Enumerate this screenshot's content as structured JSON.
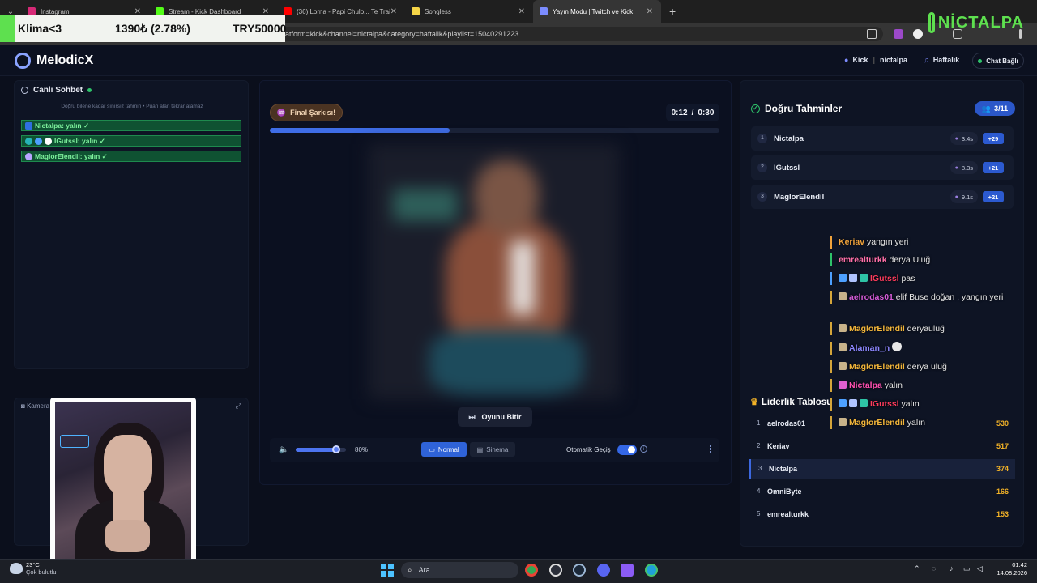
{
  "browser": {
    "tabs": [
      {
        "title": "Instagram",
        "color": "#d62976"
      },
      {
        "title": "Stream - Kick Dashboard",
        "color": "#53fc18"
      },
      {
        "title": "(36) Lorna - Papi Chulo... Te Trai",
        "color": "#ff0000"
      },
      {
        "title": "Songless",
        "color": "#f5d547"
      },
      {
        "title": "Yayın Modu | Twitch ve Kick",
        "color": "#7b8cff"
      }
    ],
    "url": "atform=kick&channel=nictalpa&category=haftalik&playlist=15040291223"
  },
  "ticker": {
    "left": "Klima<3",
    "middle": "1390₺ (2.78%)",
    "right": "TRY50000"
  },
  "brand_overlay": "NİCTALPA",
  "app": {
    "name": "MelodicX",
    "platform": "Kick",
    "channel": "nictalpa",
    "category": "Haftalık",
    "connection": "Chat Bağlı"
  },
  "chat": {
    "title": "Canlı Sohbet",
    "note": "Doğru bilene kadar sınırsız tahmin • Puan alan tekrar alamaz",
    "messages": [
      {
        "text": "Nictalpa: yalın ✓"
      },
      {
        "text": "IGutssl: yalın ✓"
      },
      {
        "text": "MaglorElendil: yalın ✓"
      }
    ]
  },
  "camera": {
    "label": "Kamera Alanı"
  },
  "player": {
    "badge": "Final Şarkısı!",
    "current_time": "0:12",
    "total_time": "0:30",
    "progress": 0.4,
    "end_button": "Oyunu Bitir",
    "volume_pct": 80,
    "volume_label": "80%",
    "mode_normal": "Normal",
    "mode_cinema": "Sinema",
    "auto_label": "Otomatik Geçiş"
  },
  "correct": {
    "title": "Doğru Tahminler",
    "count": "3/11",
    "rows": [
      {
        "rank": "1",
        "name": "Nictalpa",
        "time": "3.4s",
        "points": "+29"
      },
      {
        "rank": "2",
        "name": "IGutssl",
        "time": "8.3s",
        "points": "+21"
      },
      {
        "rank": "3",
        "name": "MaglorElendil",
        "time": "9.1s",
        "points": "+21"
      }
    ]
  },
  "leaderboard": {
    "title": "Liderlik Tablosu",
    "rows": [
      {
        "rank": "1",
        "name": "aelrodas01",
        "score": "530"
      },
      {
        "rank": "2",
        "name": "Keriav",
        "score": "517"
      },
      {
        "rank": "3",
        "name": "Nictalpa",
        "score": "374"
      },
      {
        "rank": "4",
        "name": "OmniByte",
        "score": "166"
      },
      {
        "rank": "5",
        "name": "emrealturkk",
        "score": "153"
      }
    ]
  },
  "overlay_chat": [
    {
      "user": "Keriav",
      "text": "yangın yeri",
      "color": "#f0a33c"
    },
    {
      "user": "emrealturkk",
      "text": "derya Uluğ",
      "color": "#ff6fa8"
    },
    {
      "user": "IGutssl",
      "text": "pas",
      "color": "#ff3b5c"
    },
    {
      "user": "aelrodas01",
      "text": "elif Buse doğan . yangın yeri",
      "color": "#d55bd8"
    },
    {
      "user": "MaglorElendil",
      "text": "deryauluğ",
      "color": "#f0b43a"
    },
    {
      "user": "Alaman_n",
      "text": "",
      "color": "#8c86ff"
    },
    {
      "user": "MaglorElendil",
      "text": "derya uluğ",
      "color": "#f0b43a"
    },
    {
      "user": "Nictalpa",
      "text": "yalın",
      "color": "#ff4fb0"
    },
    {
      "user": "IGutssl",
      "text": "yalın",
      "color": "#ff3b5c"
    },
    {
      "user": "MaglorElendil",
      "text": "yalın",
      "color": "#f0b43a"
    }
  ],
  "taskbar": {
    "temp": "23°C",
    "weather": "Çok bulutlu",
    "search": "Ara",
    "time": "01:42",
    "date": "14.08.2026"
  }
}
